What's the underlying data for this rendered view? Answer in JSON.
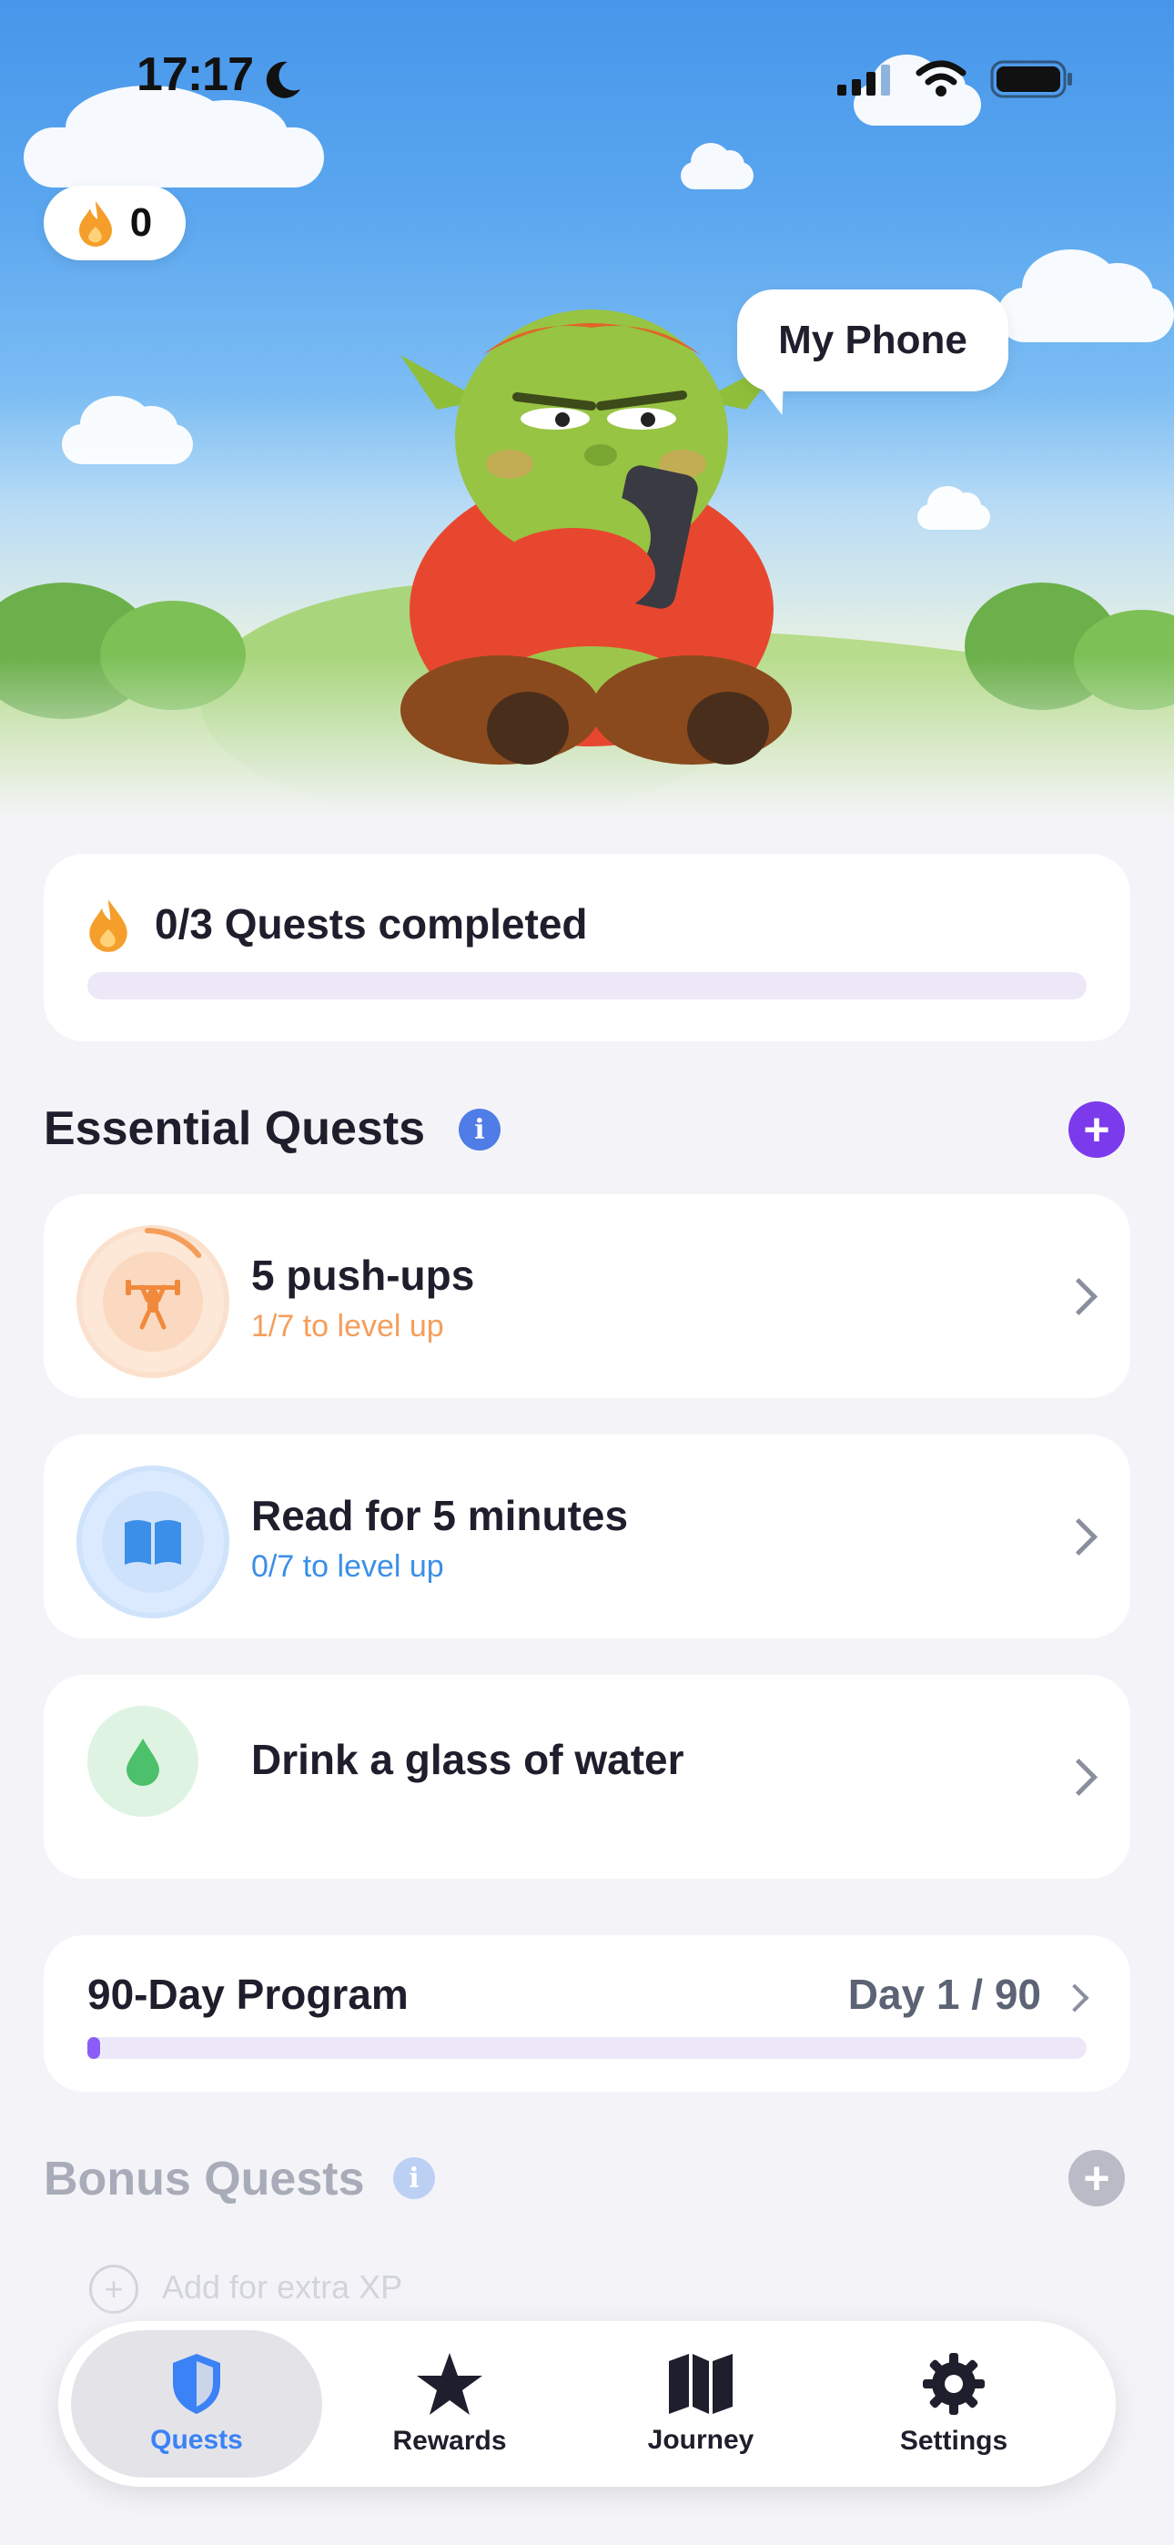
{
  "status_bar": {
    "time": "17:17"
  },
  "streak": {
    "count": "0"
  },
  "speech_bubble": {
    "text": "My Phone"
  },
  "daily_progress": {
    "label": "0/3 Quests completed",
    "completed": 0,
    "total": 3
  },
  "essential_quests": {
    "title": "Essential Quests",
    "items": [
      {
        "title": "5 push-ups",
        "subtitle": "1/7 to level up",
        "icon": "weightlifting-icon",
        "accent": "#f59e5b"
      },
      {
        "title": "Read for 5 minutes",
        "subtitle": "0/7 to level up",
        "icon": "book-icon",
        "accent": "#3b8fe8"
      },
      {
        "title": "Drink a glass of water",
        "subtitle": "",
        "icon": "water-drop-icon",
        "accent": "#4cc06a"
      }
    ]
  },
  "program": {
    "title": "90-Day Program",
    "day_label": "Day 1 / 90",
    "day": 1,
    "total_days": 90
  },
  "bonus_quests": {
    "title": "Bonus Quests",
    "add_label": "Add for extra XP"
  },
  "tabbar": {
    "tabs": [
      {
        "label": "Quests",
        "icon": "shield-icon",
        "active": true
      },
      {
        "label": "Rewards",
        "icon": "star-icon",
        "active": false
      },
      {
        "label": "Journey",
        "icon": "map-icon",
        "active": false
      },
      {
        "label": "Settings",
        "icon": "gear-icon",
        "active": false
      }
    ]
  },
  "colors": {
    "accent_purple": "#7c3aed",
    "info_blue": "#4f7ce6",
    "flame": "#f59e2b"
  }
}
